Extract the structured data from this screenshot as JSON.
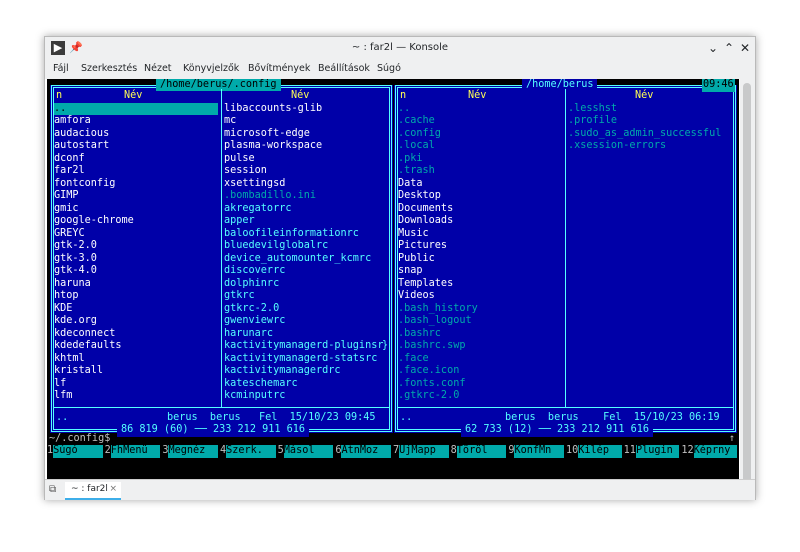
{
  "window": {
    "title": "~ : far2l — Konsole"
  },
  "menu": [
    "Fájl",
    "Szerkesztés",
    "Nézet",
    "Könyvjelzők",
    "Bővítmények",
    "Beállítások",
    "Súgó"
  ],
  "left_panel": {
    "path": "/home/berus/.config",
    "header_n": "n",
    "header_name": "Név",
    "col1": [
      "..",
      "amfora",
      "audacious",
      "autostart",
      "dconf",
      "far2l",
      "fontconfig",
      "GIMP",
      "gmic",
      "google-chrome",
      "GREYC",
      "gtk-2.0",
      "gtk-3.0",
      "gtk-4.0",
      "haruna",
      "htop",
      "KDE",
      "kde.org",
      "kdeconnect",
      "kdedefaults",
      "khtml",
      "kristall",
      "lf",
      "lfm"
    ],
    "col2_white": [
      "libaccounts-glib",
      "mc",
      "microsoft-edge",
      "plasma-workspace",
      "pulse",
      "session",
      "xsettingsd"
    ],
    "col2_cyan": [
      ".bombadillo.ini"
    ],
    "col2_bcyan": [
      "akregatorrc",
      "apper",
      "baloofileinformationrc",
      "bluedevilglobalrc",
      "device_automounter_kcmrc",
      "discoverrc",
      "dolphinrc",
      "gtkrc",
      "gtkrc-2.0",
      "gwenviewrc",
      "harunarc",
      "kactivitymanagerd-pluginsr",
      "kactivitymanagerd-statsrc",
      "kactivitymanagerdrc",
      "kateschemarc",
      "kcminputrc"
    ],
    "overflow_mark": "}",
    "status_name": "..",
    "status_info": "berus  berus   Fel  15/10/23 09:45",
    "totals": "86 819 (60)",
    "free": "233 212 911 616"
  },
  "right_panel": {
    "path": "/home/berus",
    "clock": "09:46",
    "header_n": "n",
    "header_name": "Név",
    "col1_cyan": [
      "..",
      ".cache",
      ".config",
      ".local",
      ".pki",
      ".trash"
    ],
    "col1_white": [
      "Data",
      "Desktop",
      "Documents",
      "Downloads",
      "Music",
      "Pictures",
      "Public",
      "snap",
      "Templates",
      "Videos"
    ],
    "col1_cyan2": [
      ".bash_history",
      ".bash_logout",
      ".bashrc",
      ".bashrc.swp",
      ".face",
      ".face.icon",
      ".fonts.conf",
      ".gtkrc-2.0"
    ],
    "col2_cyan": [
      ".lesshst",
      ".profile",
      ".sudo_as_admin_successful",
      ".xsession-errors"
    ],
    "status_name": "..",
    "status_info": "berus  berus    Fel  15/10/23 06:19",
    "totals": "62 733 (12)",
    "free": "233 212 911 616"
  },
  "command_line": "~/.config$",
  "keys": [
    {
      "num": "1",
      "label": "Súgó"
    },
    {
      "num": "2",
      "label": "FhMenü"
    },
    {
      "num": "3",
      "label": "Megnéz"
    },
    {
      "num": "4",
      "label": "Szerk."
    },
    {
      "num": "5",
      "label": "Másol"
    },
    {
      "num": "6",
      "label": "AtnMoz"
    },
    {
      "num": "7",
      "label": "ÚjMapp"
    },
    {
      "num": "8",
      "label": "Töröl"
    },
    {
      "num": "9",
      "label": "KonfMn"
    },
    {
      "num": "10",
      "label": "Kilép"
    },
    {
      "num": "11",
      "label": "Plugin"
    },
    {
      "num": "12",
      "label": "Képrny"
    }
  ],
  "tab": {
    "label": "~ : far2l",
    "close": "×"
  },
  "colors": {
    "panel_bg": "#0000a8",
    "frame": "#55ffff",
    "header": "#ffff55",
    "selection": "#00aaaa"
  }
}
